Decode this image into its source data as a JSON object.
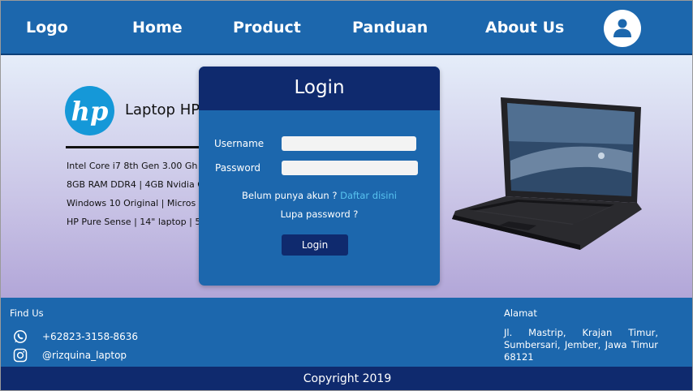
{
  "navbar": {
    "logo": "Logo",
    "items": [
      "Home",
      "Product",
      "Panduan",
      "About Us"
    ],
    "avatar_icon": "user-icon"
  },
  "product": {
    "brand_logo": "hp-logo",
    "title": "Laptop HP",
    "specs": [
      "Intel Core i7 8th Gen 3.00 Gh",
      "8GB RAM DDR4 | 4GB Nvidia G",
      "Windows 10 Original | Micros",
      "HP Pure Sense | 14\" laptop | 5"
    ]
  },
  "login": {
    "title": "Login",
    "username_label": "Username",
    "password_label": "Password",
    "username_value": "",
    "password_value": "",
    "register_prompt": "Belum punya akun ?",
    "register_link": "Daftar disini",
    "forgot": "Lupa password ?",
    "button": "Login"
  },
  "footer": {
    "find_us": "Find Us",
    "phone": "+62823-3158-8636",
    "instagram": "@rizquina_laptop",
    "address_title": "Alamat",
    "address": "Jl. Mastrip, Krajan Timur, Sumbersari, Jember, Jawa Timur 68121",
    "copyright": "Copyright 2019"
  },
  "colors": {
    "nav": "#1c67ad",
    "dark": "#0f2a6e",
    "link": "#58c3f0"
  }
}
